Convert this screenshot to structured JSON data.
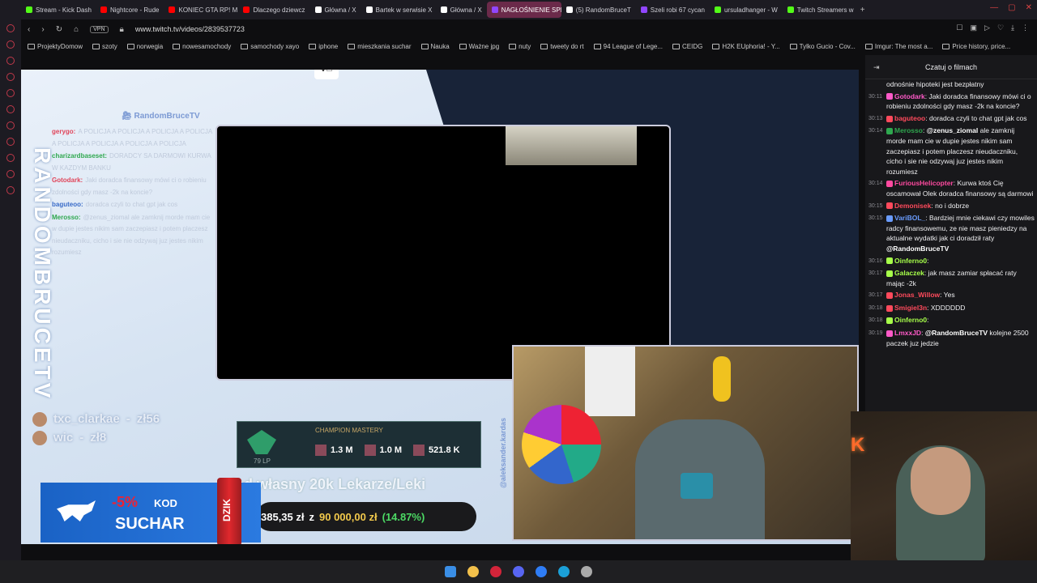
{
  "browser": {
    "tabs": [
      {
        "label": "Stream - Kick Dash",
        "color": "#53fc18"
      },
      {
        "label": "Nightcore - Rude",
        "color": "#ff0000"
      },
      {
        "label": "KONIEC GTA RP! M",
        "color": "#ff0000"
      },
      {
        "label": "Dlaczego dziewcz",
        "color": "#ff0000"
      },
      {
        "label": "Główna / X",
        "color": "#ffffff"
      },
      {
        "label": "Bartek w serwisie X",
        "color": "#ffffff"
      },
      {
        "label": "Główna / X",
        "color": "#ffffff"
      },
      {
        "label": "NAGŁOŚNIENIE SPRAV",
        "color": "#9146ff",
        "active": true
      },
      {
        "label": "(5) RandomBruceT",
        "color": "#ffffff"
      },
      {
        "label": "Szeli robi 67 cycan",
        "color": "#9146ff"
      },
      {
        "label": "ursuladhanger - W",
        "color": "#53fc18"
      },
      {
        "label": "Twitch Streamers w",
        "color": "#53fc18"
      }
    ],
    "url": "www.twitch.tv/videos/2839537723",
    "vpn_label": "VPN",
    "bookmarks": [
      "ProjektyDomow",
      "szoty",
      "norwegia",
      "nowesamochody",
      "samochody xayo",
      "iphone",
      "mieszkania suchar",
      "Nauka",
      "Ważne jpg",
      "nuty",
      "tweety do rt",
      "94 League of Lege...",
      "CEIDG",
      "H2K EUphoria! - Y...",
      "Tylko Gucio - Cov...",
      "Imgur: The most a...",
      "Price history, price..."
    ]
  },
  "stream": {
    "streamer_vertical": "RANDOMBRUCETV",
    "channel_tag": "RandomBruceTV",
    "overlay_chat": [
      {
        "user": "gerygo",
        "color": "#e0455a",
        "text": "A POLICJA A POLICJA A POLICJA A POLICJA A POLICJA A POLICJA A POLICJA A POLICJA"
      },
      {
        "user": "charizardbaseset",
        "color": "#2fa84f",
        "text": "DORADCY SA DARMOWI KURWA W KAZDYM BANKU"
      },
      {
        "user": "Gotodark",
        "color": "#e0455a",
        "text": "Jaki doradca finansowy mówi ci o robieniu zdolności gdy masz -2k na koncie?"
      },
      {
        "user": "baguteoo",
        "color": "#3a6cc8",
        "text": "doradca czyli to chat gpt jak cos"
      },
      {
        "user": "Merosso",
        "color": "#2fa84f",
        "text": "@zenus_ziomal ale zamknij morde mam cie w dupie jestes nikim sam zaczepiasz i potem placzesz nieudaczniku, cicho i sie nie odzywaj juz jestes nikim rozumiesz"
      }
    ],
    "donors": [
      {
        "name": "txc_clarkae",
        "amount": "zł56"
      },
      {
        "name": "wic",
        "amount": "zł8"
      }
    ],
    "mastery": {
      "title": "CHAMPION MASTERY",
      "level": "79 LP",
      "champs": [
        "1.3 M",
        "1.0 M",
        "521.8 K"
      ]
    },
    "sponsor": {
      "discount": "-5%",
      "kod": "KOD",
      "code": "SUCHAR",
      "can_label": "DZIK"
    },
    "goal": {
      "title": "ład własny 20k Lekarze/Leki",
      "current": "385,35 zł",
      "separator": "z",
      "target": "90 000,00 zł",
      "percent": "(14.87%)"
    },
    "twitter_handle": "@aleksander.kardas",
    "control_icon": "V⃞"
  },
  "chat": {
    "header": "Czatuj o filmach",
    "first_fragment": "odnośnie hipoteki jest bezpłatny",
    "messages": [
      {
        "time": "30:11",
        "user": "Gotodark",
        "color": "#ff5ac8",
        "text": "Jaki doradca finansowy mówi ci o robieniu zdolności gdy masz -2k na koncie?"
      },
      {
        "time": "30:13",
        "user": "baguteoo",
        "color": "#ff4a5c",
        "text": "doradca czyli to chat gpt jak cos"
      },
      {
        "time": "30:14",
        "user": "Merosso",
        "color": "#2fa84f",
        "mention": "@zenus_ziomal",
        "text": "ale zamknij morde mam cie w dupie jestes nikim sam zaczepiasz i potem placzesz nieudaczniku, cicho i sie nie odzywaj juz jestes nikim rozumiesz"
      },
      {
        "time": "30:14",
        "user": "FuriousHelicopter",
        "color": "#ff4aa0",
        "text": "Kurwa ktoś Cię oscamował Olek doradca finansowy są darmowi"
      },
      {
        "time": "30:15",
        "user": "Demonisek",
        "color": "#ff4a5c",
        "text": "no i dobrze"
      },
      {
        "time": "30:15",
        "user": "VariBOL_",
        "color": "#6a9cff",
        "text": "Bardziej mnie ciekawi czy mowiles radcy finansowemu, ze nie masz pieniedzy na aktualne wydatki jak ci doradził raty",
        "mention_end": "@RandomBruceTV"
      },
      {
        "time": "30:16",
        "user": "Oinferno0",
        "color": "#a7ff4a",
        "text": ""
      },
      {
        "time": "30:17",
        "user": "Galaczek",
        "color": "#a7ff4a",
        "text": "jak masz zamiar spłacać raty mając -2k"
      },
      {
        "time": "30:17",
        "user": "Jonas_Willow",
        "color": "#ff4a5c",
        "text": "Yes"
      },
      {
        "time": "30:18",
        "user": "Smigiel3n",
        "color": "#ff4a5c",
        "text": "XDDDDDD"
      },
      {
        "time": "30:18",
        "user": "Oinferno0",
        "color": "#a7ff4a",
        "text": ""
      },
      {
        "time": "30:19",
        "user": "LmxxJD",
        "color": "#ff5ac8",
        "mention": "@RandomBruceTV",
        "text": "kolejne 2500 paczek juz jedzie"
      }
    ]
  },
  "colors": {
    "twitch_purple": "#9146ff",
    "chat_bg": "#18181b",
    "taskbar_bg": "#1f1f22"
  },
  "taskbar": [
    "windows-start",
    "file-explorer",
    "opera",
    "discord",
    "messenger",
    "edge",
    "settings"
  ]
}
